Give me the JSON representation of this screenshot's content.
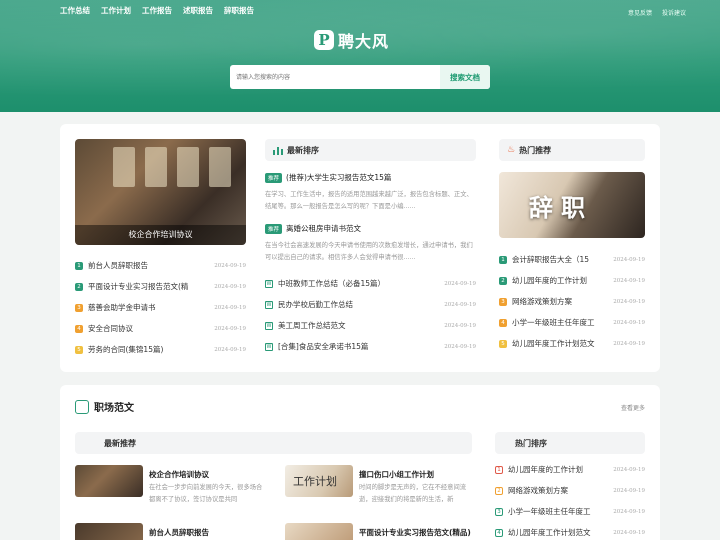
{
  "topnav": [
    "工作总结",
    "工作计划",
    "工作报告",
    "述职报告",
    "辞职报告"
  ],
  "toplinks": [
    "意见反馈",
    "投诉建议"
  ],
  "logo": {
    "mark": "P",
    "name": "聘大风"
  },
  "search": {
    "placeholder": "请输入您搜索的内容",
    "button": "搜索文档"
  },
  "colors": {
    "accent": "#2a9a77",
    "num1": "#2a9a77",
    "num2": "#2a9a77",
    "num3": "#f0a030",
    "num4": "#f0a030",
    "num5": "#f0c040"
  },
  "featured": {
    "caption": "校企合作培训协议"
  },
  "left_list": [
    {
      "n": "1",
      "title": "前台人员辞职报告",
      "date": "2024-09-19"
    },
    {
      "n": "2",
      "title": "平面设计专业实习报告范文(精",
      "date": "2024-09-19"
    },
    {
      "n": "3",
      "title": "慈善会助学金申请书",
      "date": "2024-09-19"
    },
    {
      "n": "4",
      "title": "安全合同协议",
      "date": "2024-09-19"
    },
    {
      "n": "5",
      "title": "劳务的合同(集锦15篇)",
      "date": "2024-09-19"
    }
  ],
  "latest": {
    "header": "最新排序",
    "tag": "推荐",
    "articles": [
      {
        "title": "(推荐)大学生实习报告范文15篇",
        "excerpt": "在学习、工作生活中，报告的适用范围越来越广泛，报告包含标题、正文、结尾等。那么一般报告是怎么写的呢？下面是小编......"
      },
      {
        "title": "离婚公租房申请书范文",
        "excerpt": "在当今社会高速发展的今天申请书使用的次数愈发增长，通过申请书，我们可以提出自己的请求。相信许多人会觉得申请书很......"
      }
    ],
    "list": [
      {
        "title": "中班教师工作总结（必备15篇）",
        "date": "2024-09-19"
      },
      {
        "title": "民办学校后勤工作总结",
        "date": "2024-09-19"
      },
      {
        "title": "美工周工作总结范文",
        "date": "2024-09-19"
      },
      {
        "title": "[合集]食品安全承诺书15篇",
        "date": "2024-09-19"
      }
    ]
  },
  "hot": {
    "header": "热门推荐",
    "image_text": "辞职",
    "list": [
      {
        "n": "1",
        "title": "会计辞职报告大全（15",
        "date": "2024-09-19"
      },
      {
        "n": "2",
        "title": "幼儿园年度的工作计划",
        "date": "2024-09-19"
      },
      {
        "n": "3",
        "title": "网络游戏策划方案",
        "date": "2024-09-19"
      },
      {
        "n": "4",
        "title": "小学一年级班主任年度工",
        "date": "2024-09-19"
      },
      {
        "n": "5",
        "title": "幼儿园年度工作计划范文",
        "date": "2024-09-19"
      }
    ]
  },
  "workplace": {
    "title": "职场范文",
    "more": "查看更多",
    "recommend_header": "最新推荐",
    "items": [
      {
        "title": "校企合作培训协议",
        "excerpt": "在社会一步步向前发展的今天，很多场合都离不了协议，签订协议是共同"
      },
      {
        "title": "撞口伤口小组工作计划",
        "excerpt": "时间的脚步是无声的，它在不经意间流逝，迎接我们的将是新的生活，新"
      },
      {
        "title": "前台人员辞职报告",
        "excerpt": ""
      },
      {
        "title": "平面设计专业实习报告范文(精品)",
        "excerpt": ""
      }
    ],
    "thumb_text": "工作计划",
    "hot_header": "热门排序",
    "hot_list": [
      {
        "n": "1",
        "title": "幼儿园年度的工作计划",
        "date": "2024-09-19"
      },
      {
        "n": "2",
        "title": "网络游戏策划方案",
        "date": "2024-09-19"
      },
      {
        "n": "3",
        "title": "小学一年级班主任年度工",
        "date": "2024-09-19"
      },
      {
        "n": "4",
        "title": "幼儿园年度工作计划范文",
        "date": "2024-09-19"
      }
    ]
  }
}
